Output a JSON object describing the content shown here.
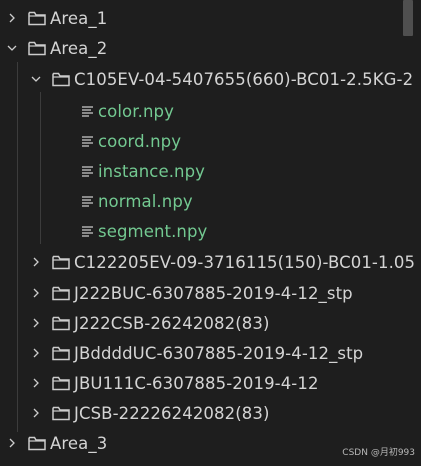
{
  "tree": {
    "area_1": {
      "label": "Area_1",
      "state": "collapsed"
    },
    "area_2": {
      "label": "Area_2",
      "state": "expanded",
      "folder_c105": {
        "label": "C105EV-04-5407655(660)-BC01-2.5KG-2",
        "state": "expanded",
        "files": [
          {
            "label": "color.npy",
            "icon": "text-file-icon"
          },
          {
            "label": "coord.npy",
            "icon": "text-file-icon"
          },
          {
            "label": "instance.npy",
            "icon": "text-file-icon"
          },
          {
            "label": "normal.npy",
            "icon": "text-file-icon"
          },
          {
            "label": "segment.npy",
            "icon": "text-file-icon"
          }
        ]
      },
      "folders_collapsed": [
        {
          "label": "C122205EV-09-3716115(150)-BC01-1.05"
        },
        {
          "label": "J222BUC-6307885-2019-4-12_stp"
        },
        {
          "label": "J222CSB-26242082(83)"
        },
        {
          "label": "JBddddUC-6307885-2019-4-12_stp"
        },
        {
          "label": "JBU111C-6307885-2019-4-12"
        },
        {
          "label": "JCSB-22226242082(83)"
        }
      ]
    },
    "area_3": {
      "label": "Area_3",
      "state": "collapsed"
    }
  },
  "colors": {
    "background": "#1e1e1e",
    "text": "#d4d4d4",
    "file_text": "#73c991",
    "icon": "#cccccc"
  },
  "watermark": "CSDN @月初993"
}
